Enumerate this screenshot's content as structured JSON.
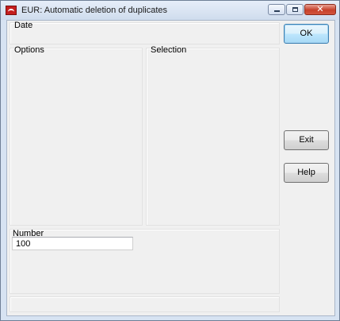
{
  "window": {
    "title": "EUR: Automatic deletion of duplicates",
    "icon": "app-logo-icon",
    "controls": [
      "minimize-icon",
      "maximize-icon",
      "close-icon"
    ]
  },
  "form": {
    "date_label": "Date",
    "options_label": "Options",
    "selection_label": "Selection",
    "number_label": "Number",
    "number_value": "100"
  },
  "buttons": {
    "ok": "OK",
    "exit": "Exit",
    "help": "Help"
  },
  "colors": {
    "dialog_bg": "#f0f0f0",
    "title_bar": "#d7e3f2",
    "close_button": "#c7402a"
  }
}
